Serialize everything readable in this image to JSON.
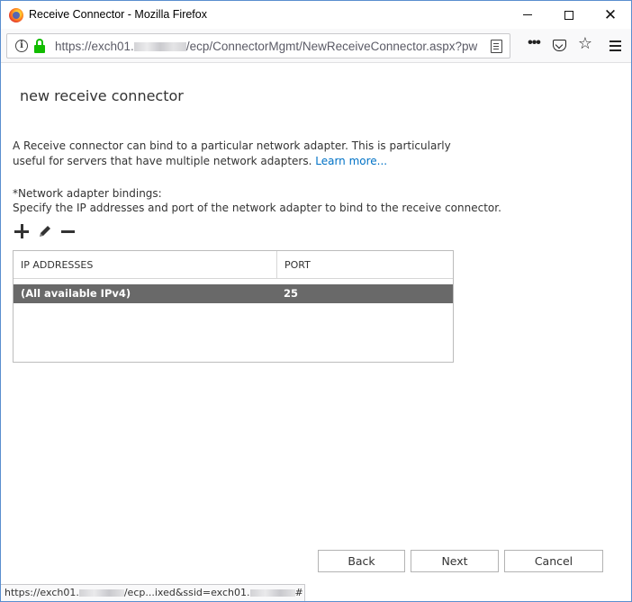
{
  "window": {
    "title": "Receive Connector - Mozilla Firefox"
  },
  "navbar": {
    "url_prefix": "https://exch01.",
    "url_suffix": "/ecp/ConnectorMgmt/NewReceiveConnector.aspx?pw"
  },
  "page": {
    "title": "new receive connector",
    "description": "A Receive connector can bind to a particular network adapter. This is particularly useful for servers that have multiple network adapters. ",
    "learn_more": "Learn more...",
    "bindings_label": "*Network adapter bindings:",
    "bindings_help": "Specify the IP addresses and port of the network adapter to bind to the receive connector."
  },
  "grid": {
    "columns": [
      "IP ADDRESSES",
      "PORT"
    ],
    "rows": [
      {
        "ip": "(All available IPv4)",
        "port": "25"
      }
    ]
  },
  "buttons": {
    "back": "Back",
    "next": "Next",
    "cancel": "Cancel"
  },
  "statusbar": {
    "prefix": "https://exch01.",
    "middle": "/ecp...ixed&ssid=exch01.",
    "suffix": "#"
  },
  "colors": {
    "selected_row": "#696969",
    "link": "#0072c6",
    "lock": "#12bc00"
  }
}
